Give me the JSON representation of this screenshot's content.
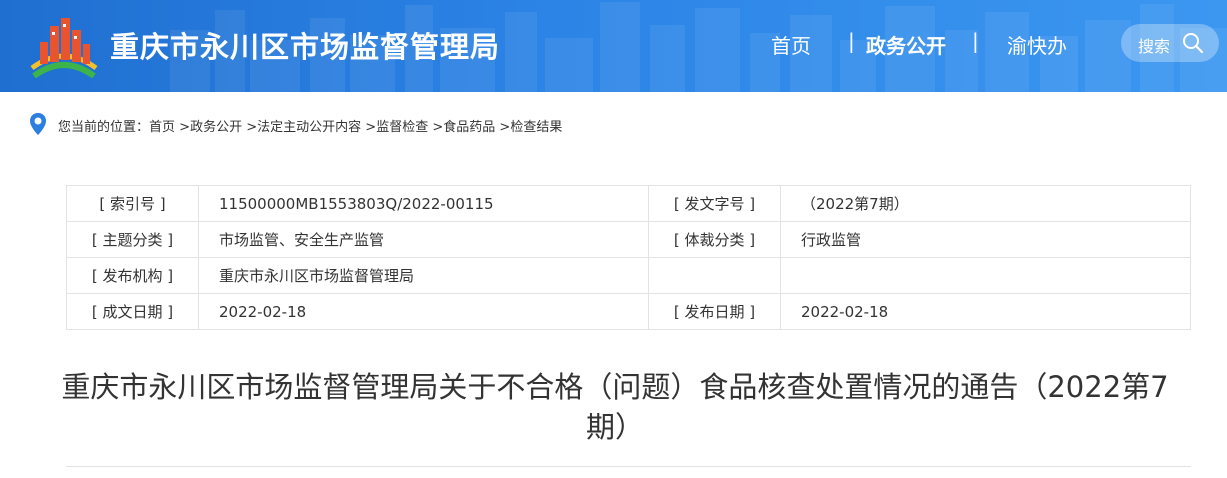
{
  "header": {
    "site_title": "重庆市永川区市场监督管理局",
    "nav": [
      {
        "label": "首页"
      },
      {
        "label": "政务公开"
      },
      {
        "label": "渝快办"
      }
    ],
    "search_label": "搜索",
    "brand_color": "#2a7fe0"
  },
  "breadcrumb": {
    "prefix": "您当前的位置：",
    "items": [
      "首页",
      "政务公开",
      "法定主动公开内容",
      "监督检查",
      "食品药品",
      "检查结果"
    ],
    "separator": ">"
  },
  "meta": {
    "rows": [
      {
        "k1": "[ 索引号 ]",
        "v1": "11500000MB1553803Q/2022-00115",
        "k2": "[ 发文字号 ]",
        "v2": "（2022第7期）"
      },
      {
        "k1": "[ 主题分类 ]",
        "v1": "市场监管、安全生产监管",
        "k2": "[ 体裁分类 ]",
        "v2": "行政监管"
      },
      {
        "k1": "[ 发布机构 ]",
        "v1": "重庆市永川区市场监督管理局",
        "k2": "",
        "v2": ""
      },
      {
        "k1": "[ 成文日期 ]",
        "v1": "2022-02-18",
        "k2": "[ 发布日期 ]",
        "v2": "2022-02-18"
      }
    ]
  },
  "document": {
    "title": "重庆市永川区市场监督管理局关于不合格（问题）食品核查处置情况的通告（2022第7期）"
  }
}
